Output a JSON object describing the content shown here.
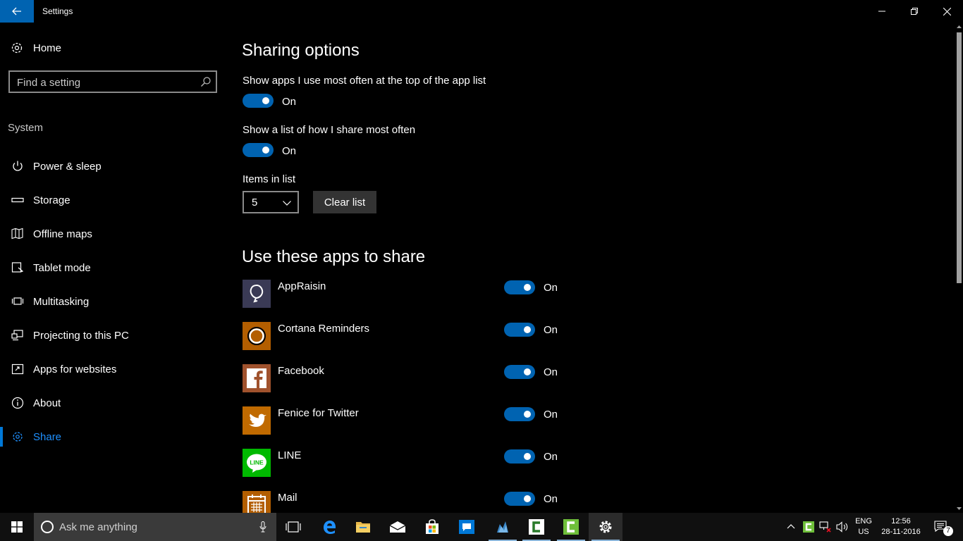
{
  "window": {
    "title": "Settings"
  },
  "sidebar": {
    "home_label": "Home",
    "search_placeholder": "Find a setting",
    "section_label": "System",
    "items": [
      {
        "label": "Power & sleep",
        "icon": "power-icon"
      },
      {
        "label": "Storage",
        "icon": "storage-icon"
      },
      {
        "label": "Offline maps",
        "icon": "map-icon"
      },
      {
        "label": "Tablet mode",
        "icon": "tablet-icon"
      },
      {
        "label": "Multitasking",
        "icon": "multitasking-icon"
      },
      {
        "label": "Projecting to this PC",
        "icon": "projecting-icon"
      },
      {
        "label": "Apps for websites",
        "icon": "apps-websites-icon"
      },
      {
        "label": "About",
        "icon": "info-icon"
      },
      {
        "label": "Share",
        "icon": "share-icon",
        "active": true
      }
    ]
  },
  "main": {
    "sharing_title": "Sharing options",
    "show_top_label": "Show apps I use most often at the top of the app list",
    "show_top_state": "On",
    "show_list_label": "Show a list of how I share most often",
    "show_list_state": "On",
    "items_label": "Items in list",
    "items_value": "5",
    "clear_label": "Clear list",
    "apps_title": "Use these apps to share",
    "apps": [
      {
        "name": "AppRaisin",
        "state": "On",
        "color": "#3a3a55"
      },
      {
        "name": "Cortana Reminders",
        "state": "On",
        "color": "#b35e00"
      },
      {
        "name": "Facebook",
        "state": "On",
        "color": "#a0522d"
      },
      {
        "name": "Fenice for Twitter",
        "state": "On",
        "color": "#c06a00"
      },
      {
        "name": "LINE",
        "state": "On",
        "color": "#00b900"
      },
      {
        "name": "Mail",
        "state": "On",
        "color": "#b35e00"
      }
    ]
  },
  "taskbar": {
    "search_placeholder": "Ask me anything",
    "lang_top": "ENG",
    "lang_bottom": "US",
    "time": "12:56",
    "date": "28-11-2016",
    "notification_count": "7"
  },
  "colors": {
    "accent": "#0063b1",
    "active_nav": "#1e90ff"
  }
}
